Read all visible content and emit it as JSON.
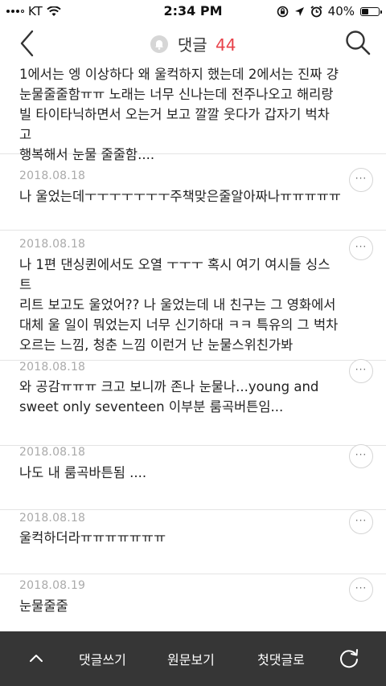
{
  "status_bar": {
    "carrier": "KT",
    "time": "2:34 PM",
    "battery_percent": "40%",
    "battery_level": 0.4
  },
  "nav": {
    "title": "댓글",
    "count": "44"
  },
  "comments": [
    {
      "date": "",
      "lines": [
        "1에서는 엥 이상하다 왜 울컥하지 했는데 2에서는 진짜 걍",
        "눈물줄줄함ㅠㅠ 노래는 너무 신나는데 전주나오고 해리랑",
        "빌 타이타닉하면서 오는거 보고 깔깔 웃다가 갑자기 벅차고",
        "행복해서 눈물 줄줄함...."
      ]
    },
    {
      "date": "2018.08.18",
      "lines": [
        "나 울었는데ㅜㅜㅜㅜㅜㅜㅜ주책맞은줄알아짜나ㅠㅠㅠㅠㅠ"
      ]
    },
    {
      "date": "2018.08.18",
      "lines": [
        "나 1편 댄싱퀸에서도 오열 ㅜㅜㅜ 혹시 여기 여시들 싱스트",
        "리트 보고도 울었어?? 나 울었는데 내 친구는 그 영화에서",
        "대체 울 일이 뭐었는지 너무 신기하대 ㅋㅋ 특유의 그 벅차",
        "오르는 느낌, 청춘 느낌 이런거 난 눈물스위친가봐"
      ]
    },
    {
      "date": "2018.08.18",
      "lines": [
        "와 공감ㅠㅠㅠ 크고 보니까 존나 눈물나...young and",
        "sweet only seventeen 이부분 룸곡버튼임..."
      ]
    },
    {
      "date": "2018.08.18",
      "lines": [
        "나도 내 룸곡바튼됨 ...."
      ]
    },
    {
      "date": "2018.08.18",
      "lines": [
        "울컥하더라ㅠㅠㅠㅠㅠㅠㅠ"
      ]
    },
    {
      "date": "2018.08.19",
      "lines": [
        "눈물줄줄"
      ]
    }
  ],
  "more_label": "···",
  "bottom_bar": {
    "write_label": "댓글쓰기",
    "original_label": "원문보기",
    "first_label": "첫댓글로"
  }
}
